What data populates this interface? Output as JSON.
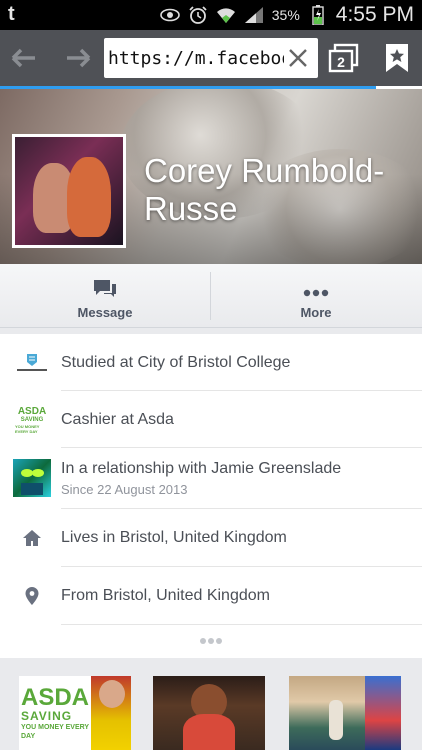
{
  "status_bar": {
    "app_letter": "t",
    "battery_percent": "35%",
    "time": "4:55 PM",
    "icons": [
      "tumblr-icon",
      "eye-icon",
      "alarm-icon",
      "wifi-icon",
      "signal-icon",
      "battery-icon"
    ]
  },
  "browser": {
    "url": "https://m.facebook.com",
    "tab_count": "2",
    "icons": [
      "back-arrow-icon",
      "forward-arrow-icon",
      "clear-x-icon",
      "tabs-icon",
      "bookmark-icon"
    ],
    "accent": "#2f9df0",
    "page_load_progress": 0.89
  },
  "profile": {
    "name": "Corey Rumbold-Russe"
  },
  "actions": [
    {
      "label": "Message",
      "icon": "message-bubbles-icon"
    },
    {
      "label": "More",
      "icon": "more-dots-icon"
    }
  ],
  "info": [
    {
      "text": "Studied at City of Bristol College",
      "sub": "",
      "icon": "college-logo-icon"
    },
    {
      "text": "Cashier at Asda",
      "sub": "",
      "icon": "asda-logo-icon"
    },
    {
      "text": "In a relationship with Jamie Greenslade",
      "sub": "Since 22 August 2013",
      "icon": "partner-photo-icon"
    },
    {
      "text": "Lives in Bristol, United Kingdom",
      "sub": "",
      "icon": "home-icon"
    },
    {
      "text": "From Bristol, United Kingdom",
      "sub": "",
      "icon": "location-pin-icon"
    }
  ],
  "asda_logo": {
    "word": "ASDA",
    "line1": "SAVING",
    "line2": "YOU MONEY EVERY DAY"
  },
  "colors": {
    "status_bar": "#000000",
    "browser_bar": "#4f5156",
    "asda_green": "#5aa83a",
    "name_text": "#ffffff"
  }
}
